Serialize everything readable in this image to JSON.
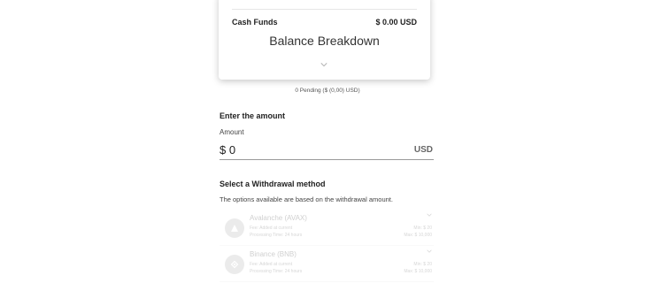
{
  "balance_card": {
    "cash_funds_label": "Cash Funds",
    "cash_funds_value": "$ 0.00 USD",
    "breakdown_title": "Balance Breakdown"
  },
  "pending_text": "0 Pending ($ (0,00) USD)",
  "amount_section": {
    "title": "Enter the amount",
    "label": "Amount",
    "currency_symbol": "$",
    "value": "0",
    "currency_code": "USD"
  },
  "withdrawal": {
    "title": "Select a Withdrawal method",
    "note": "The options available are based on the withdrawal amount.",
    "methods": [
      {
        "name": "Avalanche (AVAX)",
        "fee": "Fee: Added at current",
        "processing": "Processing Time: 24 hours",
        "min": "Min: $ 20",
        "max": "Max: $ 10,000"
      },
      {
        "name": "Binance (BNB)",
        "fee": "Fee: Added at current",
        "processing": "Processing Time: 24 hours",
        "min": "Min: $ 20",
        "max": "Max: $ 10,000"
      }
    ]
  }
}
